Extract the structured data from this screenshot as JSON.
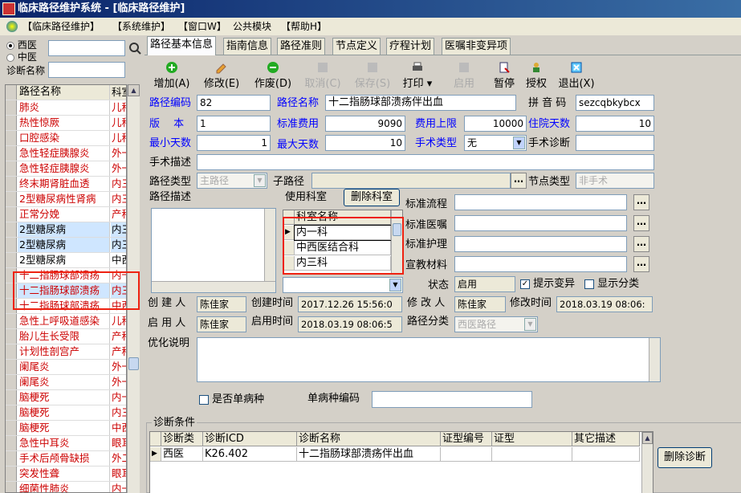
{
  "window": {
    "title": "临床路径维护系统 - [临床路径维护]"
  },
  "menu": [
    "【临床路径维护】",
    "【系统维护】",
    "【窗口W】",
    "公共模块",
    "【帮助H】"
  ],
  "left": {
    "radio_western": "西医",
    "radio_chinese": "中医",
    "search_label": "诊断名称",
    "search_value": "",
    "col_name": "路径名称",
    "col_dept": "科室",
    "rows": [
      {
        "name": "肺炎",
        "dept": "儿科"
      },
      {
        "name": "热性惊厥",
        "dept": "儿科"
      },
      {
        "name": "口腔感染",
        "dept": "儿科"
      },
      {
        "name": "急性轻症胰腺炎",
        "dept": "外一"
      },
      {
        "name": "急性轻症胰腺炎",
        "dept": "外一"
      },
      {
        "name": "终末期肾脏血透",
        "dept": "内三"
      },
      {
        "name": "2型糖尿病性肾病",
        "dept": "内三"
      },
      {
        "name": "正常分娩",
        "dept": "产科"
      },
      {
        "name": "2型糖尿病",
        "dept": "内三"
      },
      {
        "name": "2型糖尿病",
        "dept": "内三"
      },
      {
        "name": "2型糖尿病",
        "dept": "中西"
      },
      {
        "name": "十二指肠球部溃疡",
        "dept": "内一"
      },
      {
        "name": "十二指肠球部溃疡",
        "dept": "内三"
      },
      {
        "name": "十二指肠球部溃疡",
        "dept": "中西"
      },
      {
        "name": "急性上呼吸道感染",
        "dept": "儿科"
      },
      {
        "name": "胎儿生长受限",
        "dept": "产科"
      },
      {
        "name": "计划性剖宫产",
        "dept": "产科"
      },
      {
        "name": "阑尾炎",
        "dept": "外一"
      },
      {
        "name": "阑尾炎",
        "dept": "外一"
      },
      {
        "name": "脑梗死",
        "dept": "内一"
      },
      {
        "name": "脑梗死",
        "dept": "内三"
      },
      {
        "name": "脑梗死",
        "dept": "中西"
      },
      {
        "name": "急性中耳炎",
        "dept": "眼耳"
      },
      {
        "name": "手术后颅骨缺损",
        "dept": "外二"
      },
      {
        "name": "突发性聋",
        "dept": "眼耳"
      },
      {
        "name": "细菌性肺炎",
        "dept": "内一"
      }
    ]
  },
  "tabs": [
    "路径基本信息",
    "指南信息",
    "路径准则",
    "节点定义",
    "疗程计划",
    "医嘱非变异项"
  ],
  "toolbar": [
    "增加(A)",
    "修改(E)",
    "作废(D)",
    "取消(C)",
    "保存(S)",
    "打印",
    "启用",
    "暂停",
    "授权",
    "退出(X)"
  ],
  "form": {
    "code_label": "路径编码",
    "code": "82",
    "name_label": "路径名称",
    "name": "十二指肠球部溃疡伴出血",
    "pinyin_label": "拼 音 码",
    "pinyin": "sezcqbkybcx",
    "version_label": "版　 本",
    "version": "1",
    "std_fee_label": "标准费用",
    "std_fee": "9090",
    "fee_limit_label": "费用上限",
    "fee_limit": "10000",
    "stay_label": "住院天数",
    "stay": "10",
    "min_days_label": "最小天数",
    "min_days": "1",
    "max_days_label": "最大天数",
    "max_days": "10",
    "surgery_type_label": "手术类型",
    "surgery_type": "无",
    "surgery_diag_label": "手术诊断",
    "surgery_diag": "",
    "surgery_desc_label": "手术描述",
    "surgery_desc": "",
    "path_type_label": "路径类型",
    "path_type": "主路径",
    "sub_path_label": "子路径",
    "sub_path": "",
    "node_type_label": "节点类型",
    "node_type": "非手术",
    "path_desc_label": "路径描述",
    "use_dept_label": "使用科室",
    "del_dept": "删除科室",
    "dept_col": "科室名称",
    "depts": [
      "内一科",
      "中西医结合科",
      "内三科"
    ],
    "std_flow_label": "标准流程",
    "std_order_label": "标准医嘱",
    "std_nursing_label": "标准护理",
    "edu_label": "宣教材料",
    "status_label": "状态",
    "status": "启用",
    "prompt_var": "提示变异",
    "show_class": "显示分类",
    "creator_label": "创 建 人",
    "creator": "陈佳家",
    "create_time_label": "创建时间",
    "create_time": "2017.12.26 15:56:0",
    "modifier_label": "修 改 人",
    "modifier": "陈佳家",
    "modify_time_label": "修改时间",
    "modify_time": "2018.03.19 08:06:",
    "enabler_label": "启 用 人",
    "enabler": "陈佳家",
    "enable_time_label": "启用时间",
    "enable_time": "2018.03.19 08:06:5",
    "path_class_label": "路径分类",
    "path_class": "西医路径",
    "opt_label": "优化说明",
    "single_label": "是否单病种",
    "single_code_label": "单病种编码",
    "single_code": ""
  },
  "diag": {
    "group_label": "诊断条件",
    "cols": [
      "诊断类",
      "诊断ICD",
      "诊断名称",
      "证型编号",
      "证型",
      "其它描述"
    ],
    "row": [
      "西医",
      "K26.402",
      "十二指肠球部溃疡伴出血",
      "",
      "",
      ""
    ],
    "del_button": "删除诊断"
  }
}
